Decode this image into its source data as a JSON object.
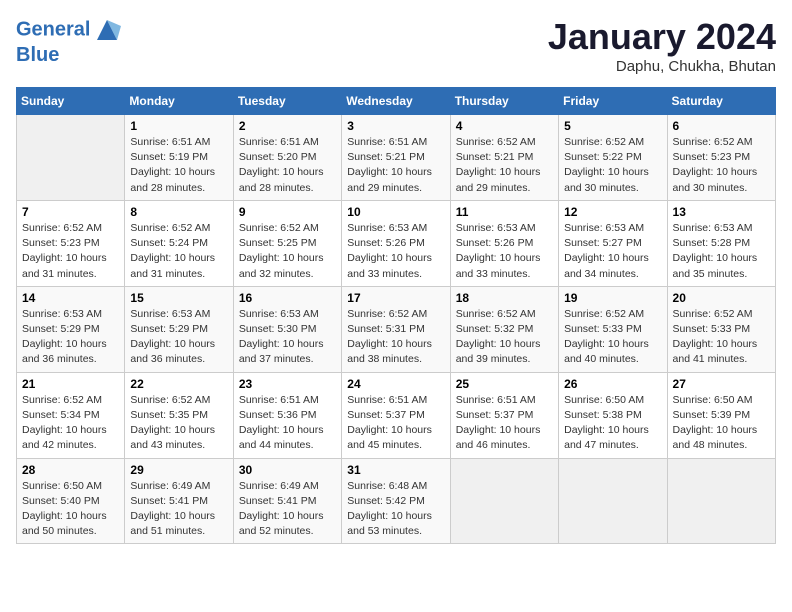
{
  "header": {
    "logo_line1": "General",
    "logo_line2": "Blue",
    "title": "January 2024",
    "subtitle": "Daphu, Chukha, Bhutan"
  },
  "weekdays": [
    "Sunday",
    "Monday",
    "Tuesday",
    "Wednesday",
    "Thursday",
    "Friday",
    "Saturday"
  ],
  "weeks": [
    [
      {
        "day": "",
        "info": ""
      },
      {
        "day": "1",
        "info": "Sunrise: 6:51 AM\nSunset: 5:19 PM\nDaylight: 10 hours\nand 28 minutes."
      },
      {
        "day": "2",
        "info": "Sunrise: 6:51 AM\nSunset: 5:20 PM\nDaylight: 10 hours\nand 28 minutes."
      },
      {
        "day": "3",
        "info": "Sunrise: 6:51 AM\nSunset: 5:21 PM\nDaylight: 10 hours\nand 29 minutes."
      },
      {
        "day": "4",
        "info": "Sunrise: 6:52 AM\nSunset: 5:21 PM\nDaylight: 10 hours\nand 29 minutes."
      },
      {
        "day": "5",
        "info": "Sunrise: 6:52 AM\nSunset: 5:22 PM\nDaylight: 10 hours\nand 30 minutes."
      },
      {
        "day": "6",
        "info": "Sunrise: 6:52 AM\nSunset: 5:23 PM\nDaylight: 10 hours\nand 30 minutes."
      }
    ],
    [
      {
        "day": "7",
        "info": "Sunrise: 6:52 AM\nSunset: 5:23 PM\nDaylight: 10 hours\nand 31 minutes."
      },
      {
        "day": "8",
        "info": "Sunrise: 6:52 AM\nSunset: 5:24 PM\nDaylight: 10 hours\nand 31 minutes."
      },
      {
        "day": "9",
        "info": "Sunrise: 6:52 AM\nSunset: 5:25 PM\nDaylight: 10 hours\nand 32 minutes."
      },
      {
        "day": "10",
        "info": "Sunrise: 6:53 AM\nSunset: 5:26 PM\nDaylight: 10 hours\nand 33 minutes."
      },
      {
        "day": "11",
        "info": "Sunrise: 6:53 AM\nSunset: 5:26 PM\nDaylight: 10 hours\nand 33 minutes."
      },
      {
        "day": "12",
        "info": "Sunrise: 6:53 AM\nSunset: 5:27 PM\nDaylight: 10 hours\nand 34 minutes."
      },
      {
        "day": "13",
        "info": "Sunrise: 6:53 AM\nSunset: 5:28 PM\nDaylight: 10 hours\nand 35 minutes."
      }
    ],
    [
      {
        "day": "14",
        "info": "Sunrise: 6:53 AM\nSunset: 5:29 PM\nDaylight: 10 hours\nand 36 minutes."
      },
      {
        "day": "15",
        "info": "Sunrise: 6:53 AM\nSunset: 5:29 PM\nDaylight: 10 hours\nand 36 minutes."
      },
      {
        "day": "16",
        "info": "Sunrise: 6:53 AM\nSunset: 5:30 PM\nDaylight: 10 hours\nand 37 minutes."
      },
      {
        "day": "17",
        "info": "Sunrise: 6:52 AM\nSunset: 5:31 PM\nDaylight: 10 hours\nand 38 minutes."
      },
      {
        "day": "18",
        "info": "Sunrise: 6:52 AM\nSunset: 5:32 PM\nDaylight: 10 hours\nand 39 minutes."
      },
      {
        "day": "19",
        "info": "Sunrise: 6:52 AM\nSunset: 5:33 PM\nDaylight: 10 hours\nand 40 minutes."
      },
      {
        "day": "20",
        "info": "Sunrise: 6:52 AM\nSunset: 5:33 PM\nDaylight: 10 hours\nand 41 minutes."
      }
    ],
    [
      {
        "day": "21",
        "info": "Sunrise: 6:52 AM\nSunset: 5:34 PM\nDaylight: 10 hours\nand 42 minutes."
      },
      {
        "day": "22",
        "info": "Sunrise: 6:52 AM\nSunset: 5:35 PM\nDaylight: 10 hours\nand 43 minutes."
      },
      {
        "day": "23",
        "info": "Sunrise: 6:51 AM\nSunset: 5:36 PM\nDaylight: 10 hours\nand 44 minutes."
      },
      {
        "day": "24",
        "info": "Sunrise: 6:51 AM\nSunset: 5:37 PM\nDaylight: 10 hours\nand 45 minutes."
      },
      {
        "day": "25",
        "info": "Sunrise: 6:51 AM\nSunset: 5:37 PM\nDaylight: 10 hours\nand 46 minutes."
      },
      {
        "day": "26",
        "info": "Sunrise: 6:50 AM\nSunset: 5:38 PM\nDaylight: 10 hours\nand 47 minutes."
      },
      {
        "day": "27",
        "info": "Sunrise: 6:50 AM\nSunset: 5:39 PM\nDaylight: 10 hours\nand 48 minutes."
      }
    ],
    [
      {
        "day": "28",
        "info": "Sunrise: 6:50 AM\nSunset: 5:40 PM\nDaylight: 10 hours\nand 50 minutes."
      },
      {
        "day": "29",
        "info": "Sunrise: 6:49 AM\nSunset: 5:41 PM\nDaylight: 10 hours\nand 51 minutes."
      },
      {
        "day": "30",
        "info": "Sunrise: 6:49 AM\nSunset: 5:41 PM\nDaylight: 10 hours\nand 52 minutes."
      },
      {
        "day": "31",
        "info": "Sunrise: 6:48 AM\nSunset: 5:42 PM\nDaylight: 10 hours\nand 53 minutes."
      },
      {
        "day": "",
        "info": ""
      },
      {
        "day": "",
        "info": ""
      },
      {
        "day": "",
        "info": ""
      }
    ]
  ]
}
